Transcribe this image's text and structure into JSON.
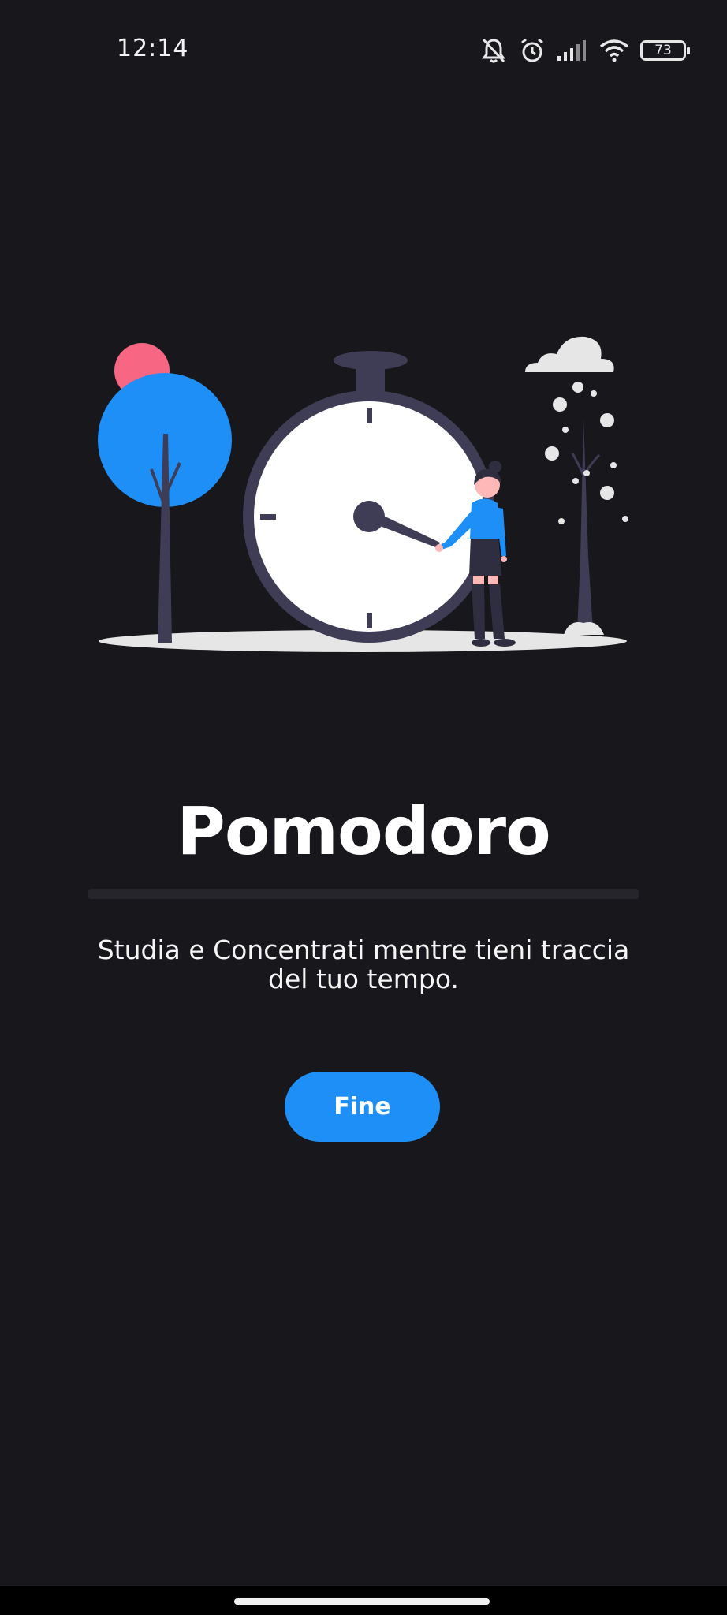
{
  "status_bar": {
    "time": "12:14",
    "battery_level": "73",
    "icons": [
      "mute-icon",
      "alarm-icon",
      "signal-icon",
      "wifi-icon",
      "battery-icon"
    ]
  },
  "illustration": {
    "description_icon": "stopwatch-illustration"
  },
  "main": {
    "title": "Pomodoro",
    "subtitle": "Studia e Concentrati mentre tieni traccia del tuo tempo.",
    "done_button_label": "Fine"
  },
  "colors": {
    "background": "#18171c",
    "accent": "#1e8ff6",
    "pink": "#f76683",
    "clock_ring": "#3f3d56",
    "ground": "#e6e6e6"
  }
}
